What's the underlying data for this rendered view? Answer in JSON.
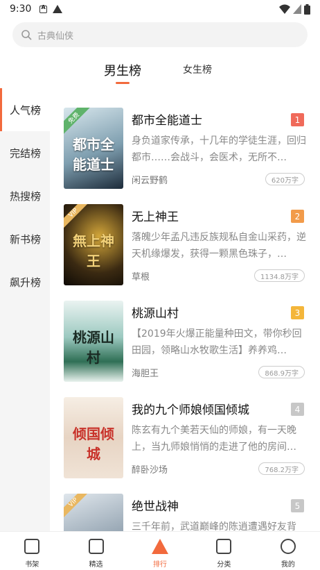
{
  "status_bar": {
    "time": "9:30"
  },
  "search": {
    "placeholder": "古典仙侠"
  },
  "tabs": [
    {
      "label": "男生榜",
      "active": true
    },
    {
      "label": "女生榜",
      "active": false
    }
  ],
  "sidebar": {
    "items": [
      {
        "label": "人气榜",
        "active": true
      },
      {
        "label": "完结榜"
      },
      {
        "label": "热搜榜"
      },
      {
        "label": "新书榜"
      },
      {
        "label": "飙升榜"
      }
    ]
  },
  "colors": {
    "accent": "#f26a3d",
    "rank1": "#f06a5a",
    "rank2": "#f29b4a",
    "rank3": "#f4b63a",
    "rank_other": "#c7c7c7"
  },
  "books": [
    {
      "rank": "1",
      "title": "都市全能道士",
      "desc": "身负道家传承，十几年的学徒生涯，回归都市……会战斗，会医术，无所不…",
      "author": "闲云野鹤",
      "words": "620万字",
      "cover_badge": "免费",
      "cover_title": "都市全能道士"
    },
    {
      "rank": "2",
      "title": "无上神王",
      "desc": "落魄少年孟凡违反族规私自金山采药，逆天机缘爆发，获得一颗黑色珠子，…",
      "author": "草根",
      "words": "1134.8万字",
      "cover_badge": "VIP",
      "cover_title": "無上神王"
    },
    {
      "rank": "3",
      "title": "桃源山村",
      "desc": "【2019年火爆正能量种田文，带你秒回田园，领略山水牧歌生活】养养鸡…",
      "author": "海胆王",
      "words": "868.9万字",
      "cover_badge": "",
      "cover_title": "桃源山村"
    },
    {
      "rank": "4",
      "title": "我的九个师娘倾国倾城",
      "desc": "陈玄有九个美若天仙的师娘，有一天晚上，当九师娘悄悄的走进了他的房间…",
      "author": "醉卧沙场",
      "words": "768.2万字",
      "cover_badge": "",
      "cover_title": "倾国倾城"
    },
    {
      "rank": "5",
      "title": "绝世战神",
      "desc": "三千年前，武道巅峰的陈逍遭遇好友背叛…",
      "author": "",
      "words": "",
      "cover_badge": "VIP",
      "cover_title": ""
    }
  ],
  "bottom_nav": [
    {
      "label": "书架",
      "icon": "bookshelf-icon"
    },
    {
      "label": "精选",
      "icon": "featured-icon"
    },
    {
      "label": "排行",
      "icon": "ranking-icon",
      "active": true
    },
    {
      "label": "分类",
      "icon": "category-icon"
    },
    {
      "label": "我的",
      "icon": "profile-icon"
    }
  ]
}
